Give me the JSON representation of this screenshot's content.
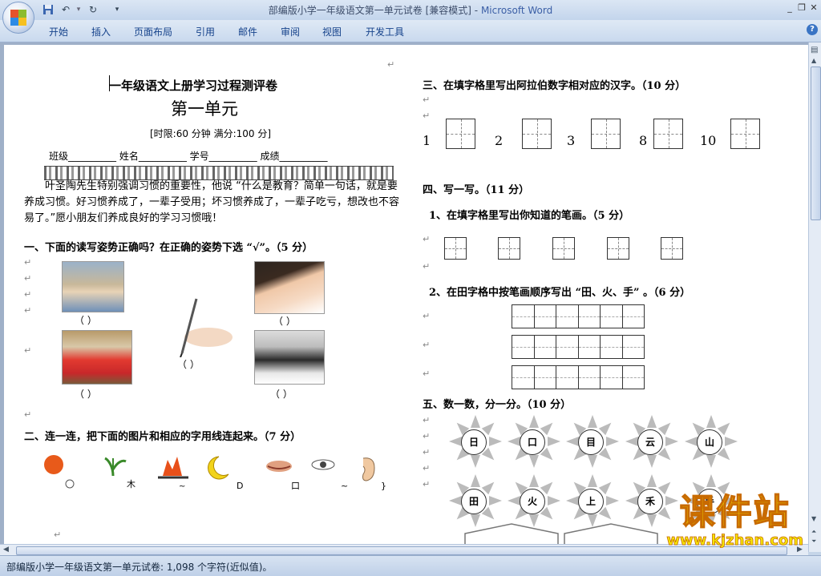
{
  "window": {
    "title": "部编版小学一年级语文第一单元试卷 [兼容模式]",
    "app_name": "Microsoft Word",
    "separator": " - "
  },
  "ribbon": {
    "tabs": [
      "开始",
      "插入",
      "页面布局",
      "引用",
      "邮件",
      "审阅",
      "视图",
      "开发工具"
    ],
    "help_label": "?"
  },
  "doc": {
    "title": "一年级语文上册学习过程测评卷",
    "unit": "第一单元",
    "limits": "[时限:60 分钟    满分:100 分]",
    "info_line": "班级__________  姓名__________  学号__________  成绩__________",
    "intro": "叶圣陶先生特别强调习惯的重要性，他说 “什么是教育？简单一句话，就是要养成习惯。好习惯养成了，一辈子受用；坏习惯养成了，一辈子吃亏，想改也不容易了。”愿小朋友们养成良好的学习习惯哦！",
    "q1": "一、下面的读写姿势正确吗？在正确的姿势下选 “√”。（5 分）",
    "paren": "（     ）",
    "q2": "二、连一连，把下面的图片和相应的字用线连起来。（7 分）",
    "q3": "三、在填字格里写出阿拉伯数字相对应的汉字。（10 分）",
    "numbers": [
      "1",
      "2",
      "3",
      "8",
      "10"
    ],
    "q4": "四、写一写。（11 分）",
    "q4_1": "1、在填字格里写出你知道的笔画。（5 分）",
    "q4_2": "2、在田字格中按笔画顺序写出 “田、火、手” 。（6 分）",
    "q5": "五、数一数，分一分。（10 分）",
    "sun_chars": [
      "日",
      "口",
      "目",
      "云",
      "山",
      "田",
      "火",
      "上",
      "禾",
      "手"
    ],
    "para_mark": "↵"
  },
  "status": {
    "text": "部编版小学一年级语文第一单元试卷: 1,098 个字符(近似值)。"
  },
  "watermark": {
    "brand": "课件站",
    "url": "www.kjzhan.com"
  },
  "colors": {
    "accent": "#15428b",
    "watermark_fill": "#f5e600",
    "watermark_stroke": "#c86a00"
  }
}
